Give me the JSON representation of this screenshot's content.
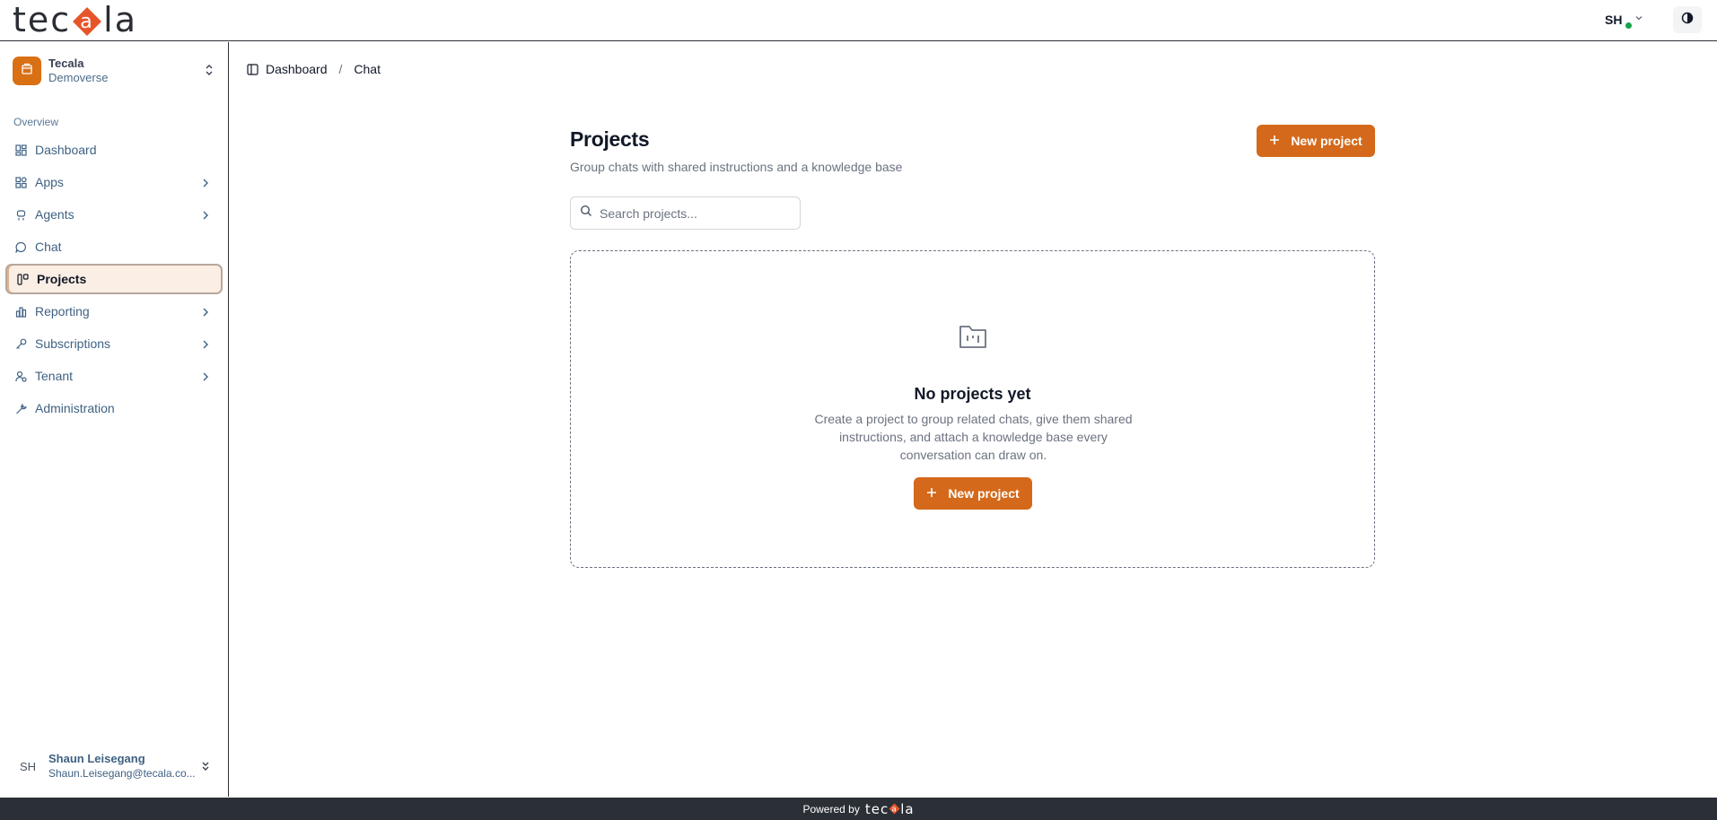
{
  "brand": {
    "logo_text_start": "tec",
    "logo_text_end": "la",
    "accent": "#d4691b"
  },
  "topbar": {
    "user_initials": "SH",
    "status_color": "#16a34a"
  },
  "sidebar": {
    "tenant": {
      "name": "Tecala",
      "sub": "Demoverse"
    },
    "section_label": "Overview",
    "items": [
      {
        "label": "Dashboard",
        "icon": "dashboard-icon",
        "has_chevron": false
      },
      {
        "label": "Apps",
        "icon": "apps-icon",
        "has_chevron": true
      },
      {
        "label": "Agents",
        "icon": "agents-icon",
        "has_chevron": true
      },
      {
        "label": "Chat",
        "icon": "chat-bubble-icon",
        "has_chevron": false
      },
      {
        "label": "Projects",
        "icon": "projects-icon",
        "has_chevron": false,
        "active": true
      },
      {
        "label": "Reporting",
        "icon": "bar-chart-icon",
        "has_chevron": true
      },
      {
        "label": "Subscriptions",
        "icon": "key-icon",
        "has_chevron": true
      },
      {
        "label": "Tenant",
        "icon": "tenant-icon",
        "has_chevron": true
      },
      {
        "label": "Administration",
        "icon": "wrench-icon",
        "has_chevron": false
      }
    ],
    "profile": {
      "initials": "SH",
      "name": "Shaun Leisegang",
      "email": "Shaun.Leisegang@tecala.co..."
    }
  },
  "breadcrumb": {
    "items": [
      "Dashboard",
      "Chat"
    ],
    "separator": "/"
  },
  "main": {
    "title": "Projects",
    "subtitle": "Group chats with shared instructions and a knowledge base",
    "new_project_label": "New project",
    "search_placeholder": "Search projects...",
    "empty": {
      "title": "No projects yet",
      "description": "Create a project to group related chats, give them shared instructions, and attach a knowledge base every conversation can draw on.",
      "button_label": "New project"
    }
  },
  "footer": {
    "powered_by": "Powered by"
  }
}
